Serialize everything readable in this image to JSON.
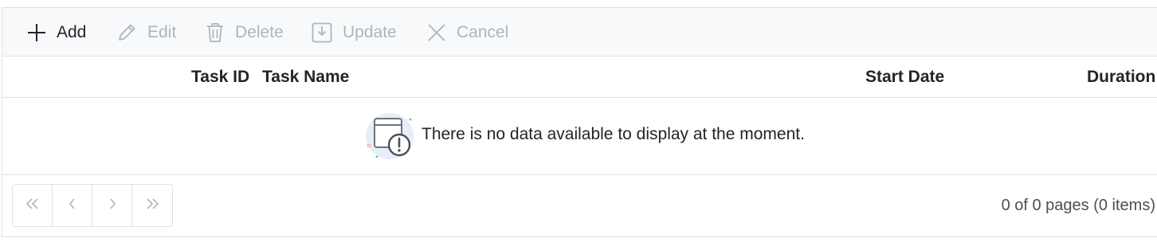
{
  "toolbar": {
    "add_label": "Add",
    "edit_label": "Edit",
    "delete_label": "Delete",
    "update_label": "Update",
    "cancel_label": "Cancel"
  },
  "columns": {
    "task_id": "Task ID",
    "task_name": "Task Name",
    "start_date": "Start Date",
    "duration": "Duration"
  },
  "empty": {
    "message": "There is no data available to display at the moment."
  },
  "pager": {
    "info": "0 of 0 pages (0 items)"
  },
  "icons": {
    "add": "plus-icon",
    "edit": "pencil-icon",
    "delete": "trash-icon",
    "update": "save-icon",
    "cancel": "close-icon",
    "first": "double-chevron-left-icon",
    "prev": "chevron-left-icon",
    "next": "chevron-right-icon",
    "last": "double-chevron-right-icon",
    "empty": "no-data-icon"
  },
  "colors": {
    "enabled_text": "#212529",
    "disabled_text": "#adb5bd",
    "border": "#dee2e6",
    "toolbar_bg": "#f8f9fa"
  }
}
